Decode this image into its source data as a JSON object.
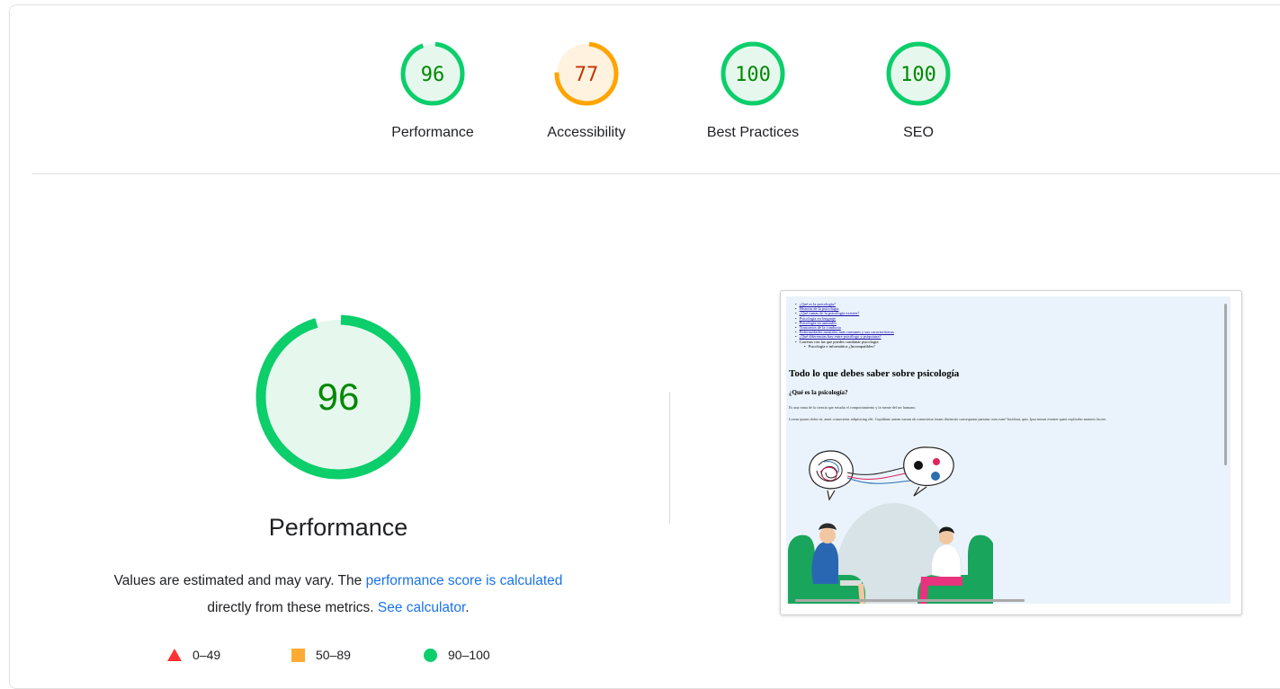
{
  "gauges": [
    {
      "score": "96",
      "label": "Performance",
      "value": 96,
      "color": "#0cce6b",
      "bg": "#e6f8ee",
      "text": "#008800"
    },
    {
      "score": "77",
      "label": "Accessibility",
      "value": 77,
      "color": "#ffa400",
      "bg": "#fff3e0",
      "text": "#c33300"
    },
    {
      "score": "100",
      "label": "Best Practices",
      "value": 100,
      "color": "#0cce6b",
      "bg": "#e6f8ee",
      "text": "#008800"
    },
    {
      "score": "100",
      "label": "SEO",
      "value": 100,
      "color": "#0cce6b",
      "bg": "#e6f8ee",
      "text": "#008800"
    }
  ],
  "main": {
    "score": "96",
    "value": 96,
    "title": "Performance",
    "desc_prefix": "Values are estimated and may vary. The ",
    "desc_link1": "performance score is calculated",
    "desc_middle": " directly from these metrics. ",
    "desc_link2": "See calculator",
    "desc_suffix": "."
  },
  "legend": [
    {
      "shape": "triangle",
      "range": "0–49",
      "color": "#ff3333"
    },
    {
      "shape": "square",
      "range": "50–89",
      "color": "#ffaa33"
    },
    {
      "shape": "circle",
      "range": "90–100",
      "color": "#0cce6b"
    }
  ],
  "screenshot": {
    "toc": [
      "¿Qué es la psicología?",
      "Historia de la psicología",
      "¿Qué ramas de la psicología existen?",
      "Psicología en lenguaje",
      "Psicología en animales",
      "Trastornos de la conducta",
      "Enfermedades mentales más comunes y sus características",
      "¿Qué diferencias hay entre psicólogo y psiquiatra?",
      "Carreras con las que puedes combinar psicología",
      "Psicología e informática ¿Incompatibles?"
    ],
    "heading": "Todo lo que debes saber sobre psicología",
    "subheading": "¿Qué es la psicología?",
    "para1": "Es una rama de la ciencia que estudia el comportamiento y la mente del ser humano.",
    "para2": "Lorem ipsum dolor sit, amet consectetur adipisicing elit. Cupiditate autem earum ab consectetur totam distinctio consequatur pariatur cum eum? Incidunt, quis. Ipsa minus eveniet quasi explicabo maiores facere."
  }
}
